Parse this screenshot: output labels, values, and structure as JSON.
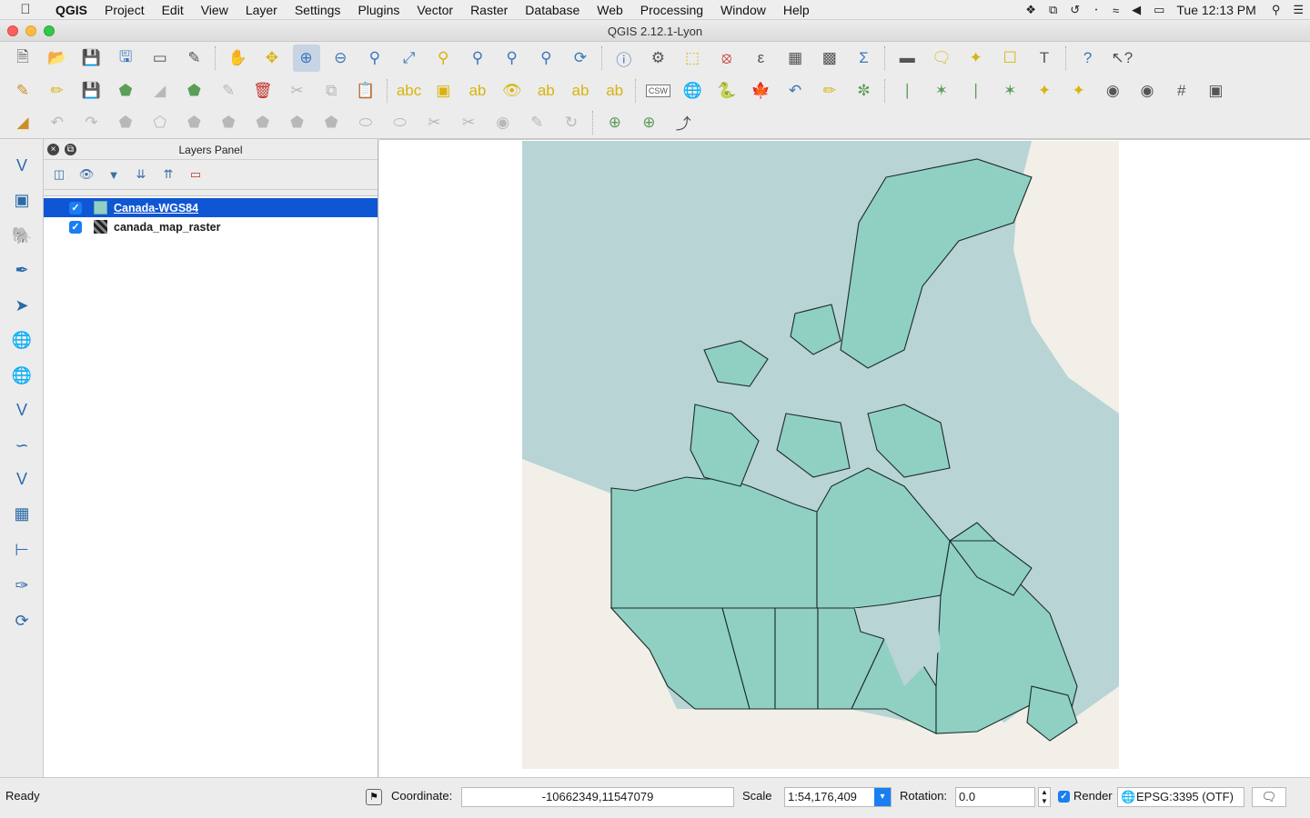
{
  "menubar": {
    "app_name": "QGIS",
    "items": [
      "Project",
      "Edit",
      "View",
      "Layer",
      "Settings",
      "Plugins",
      "Vector",
      "Raster",
      "Database",
      "Web",
      "Processing",
      "Window",
      "Help"
    ],
    "clock": "Tue 12:13 PM",
    "status_icons": [
      "dropbox-icon",
      "copy-icon",
      "time-machine-icon",
      "bluetooth-icon",
      "wifi-icon",
      "volume-icon",
      "battery-icon",
      "search-icon",
      "list-icon"
    ]
  },
  "window": {
    "title": "QGIS 2.12.1-Lyon"
  },
  "toolbar": {
    "csw_label": "CSW"
  },
  "layers_panel": {
    "title": "Layers Panel",
    "layers": [
      {
        "name": "Canada-WGS84",
        "visible": true,
        "type": "polygon",
        "selected": true
      },
      {
        "name": "canada_map_raster",
        "visible": true,
        "type": "raster",
        "selected": false
      }
    ]
  },
  "statusbar": {
    "ready": "Ready",
    "coordinate_label": "Coordinate:",
    "coordinate_value": "-10662349,11547079",
    "scale_label": "Scale",
    "scale_value": "1:54,176,409",
    "rotation_label": "Rotation:",
    "rotation_value": "0.0",
    "render_label": "Render",
    "crs": "EPSG:3395 (OTF)"
  },
  "colors": {
    "selection": "#0f56d4",
    "polygon_fill": "#8fd0c3",
    "ocean": "#b8d4d4",
    "land": "#f1efe8"
  }
}
